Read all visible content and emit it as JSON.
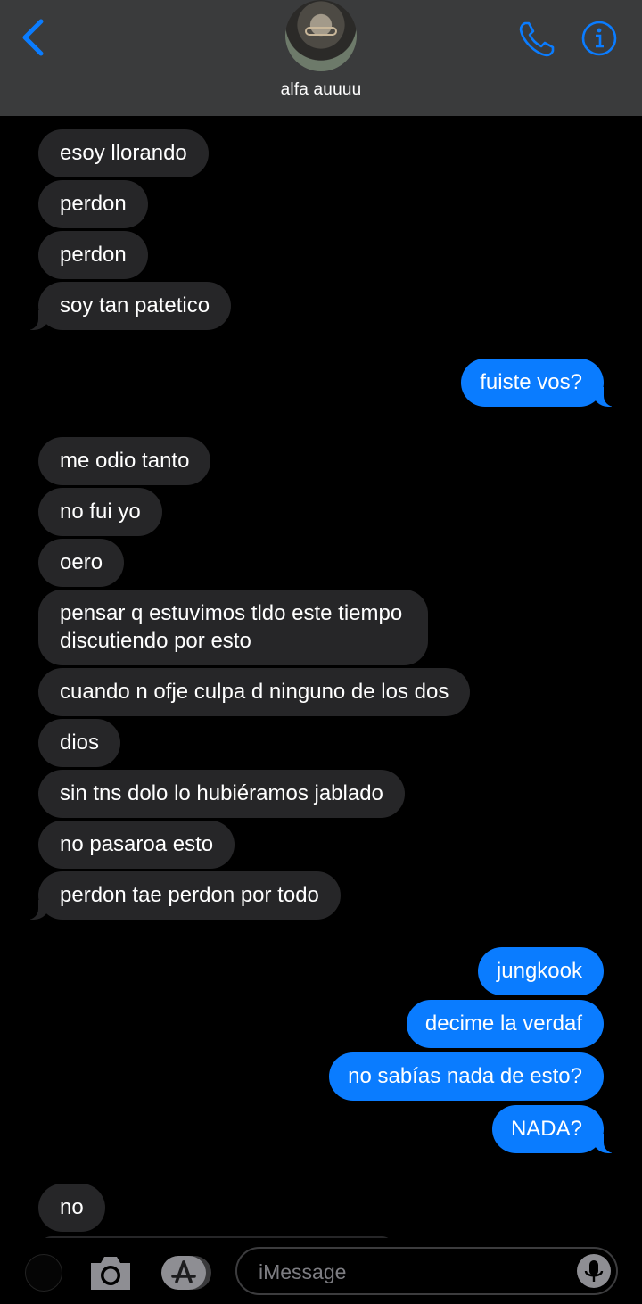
{
  "header": {
    "contact_name": "alfa auuuu",
    "back_icon": "chevron-left-icon",
    "call_icon": "phone-icon",
    "info_icon": "info-icon",
    "accent_color": "#0a7cff",
    "bar_color": "#3a3b3c"
  },
  "messages": [
    {
      "from": "them",
      "text": "esoy llorando"
    },
    {
      "from": "them",
      "text": "perdon"
    },
    {
      "from": "them",
      "text": "perdon"
    },
    {
      "from": "them",
      "text": "soy tan patetico"
    },
    {
      "from": "me",
      "text": "fuiste vos?"
    },
    {
      "from": "them",
      "text": "me odio tanto"
    },
    {
      "from": "them",
      "text": "no fui yo"
    },
    {
      "from": "them",
      "text": "oero"
    },
    {
      "from": "them",
      "text": "pensar q estuvimos tldo este tiempo discutiendo por esto"
    },
    {
      "from": "them",
      "text": "cuando n ofje culpa d ninguno de los dos"
    },
    {
      "from": "them",
      "text": "dios"
    },
    {
      "from": "them",
      "text": "sin tns dolo lo hubiéramos jablado"
    },
    {
      "from": "them",
      "text": "no pasaroa esto"
    },
    {
      "from": "them",
      "text": "perdon tae perdon por todo"
    },
    {
      "from": "me",
      "text": "jungkook"
    },
    {
      "from": "me",
      "text": "decime la verdaf"
    },
    {
      "from": "me",
      "text": "no sabías nada de esto?"
    },
    {
      "from": "me",
      "text": "NADA?"
    },
    {
      "from": "them",
      "text": "no"
    }
  ],
  "input_bar": {
    "placeholder": "iMessage",
    "camera_icon": "camera-icon",
    "apps_icon": "app-store-icon",
    "mic_icon": "microphone-icon"
  },
  "colors": {
    "incoming_bubble": "#262628",
    "outgoing_bubble": "#0a7cff",
    "background": "#000000"
  }
}
